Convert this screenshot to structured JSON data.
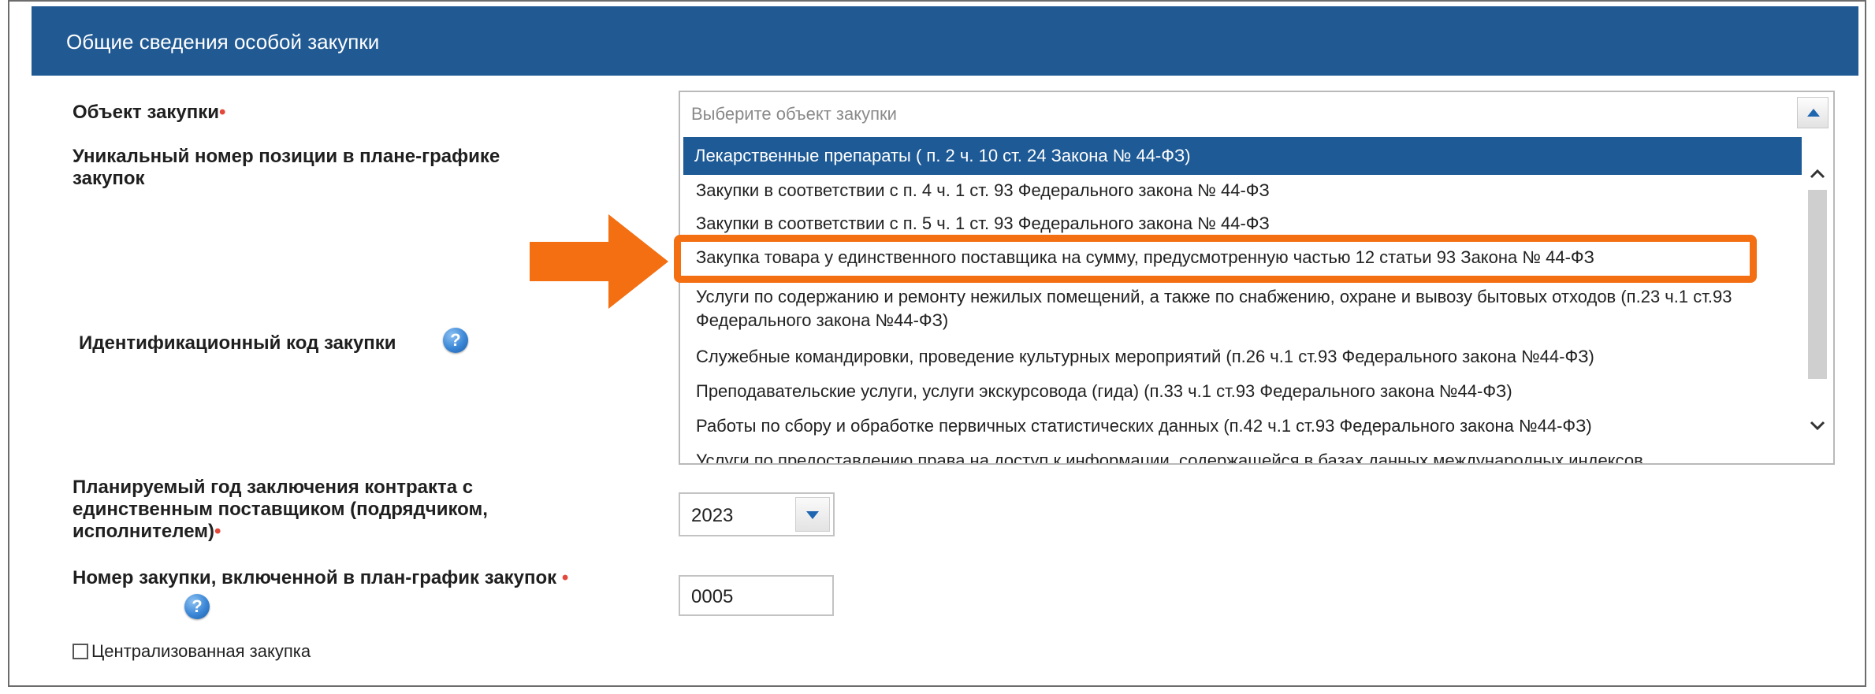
{
  "section": {
    "title": "Общие сведения особой закупки"
  },
  "fields": {
    "object_label": "Объект закупки",
    "required_mark": "•",
    "unique_position_label": "Уникальный номер позиции в плане-графике закупок",
    "identification_code_label": "Идентификационный код закупки",
    "planned_year_label": "Планируемый год заключения контракта с единственным поставщиком (подрядчиком, исполнителем)",
    "purchase_number_label": "Номер закупки, включенной в план-график закупок",
    "help_icon_glyph": "?"
  },
  "object_select": {
    "placeholder": "Выберите объект закупки",
    "options": [
      "Лекарственные препараты ( п. 2 ч. 10 ст. 24 Закона № 44-ФЗ)",
      "Закупки в соответствии с п. 4 ч. 1 ст. 93 Федерального закона № 44-ФЗ",
      "Закупки в соответствии с п. 5 ч. 1 ст. 93 Федерального закона № 44-ФЗ",
      "Закупка товара у единственного поставщика на сумму, предусмотренную частью 12 статьи 93 Закона № 44-ФЗ",
      "Услуги по содержанию и ремонту нежилых помещений, а также по снабжению, охране и вывозу бытовых отходов (п.23 ч.1 ст.93 Федерального закона №44-ФЗ)",
      "Служебные командировки, проведение культурных мероприятий (п.26 ч.1 ст.93 Федерального закона №44-ФЗ)",
      "Преподавательские услуги, услуги экскурсовода (гида) (п.33 ч.1 ст.93 Федерального закона №44-ФЗ)",
      "Работы по сбору и обработке первичных статистических данных (п.42 ч.1 ст.93 Федерального закона №44-ФЗ)",
      "Услуги по предоставлению права на доступ к информации, содержащейся в базах данных международных индексов"
    ],
    "selected_index": 0,
    "highlighted_index": 3
  },
  "year_select": {
    "value": "2023"
  },
  "purchase_number": {
    "value": "0005"
  },
  "centralized": {
    "label": "Централизованная закупка",
    "checked": false
  },
  "colors": {
    "header_bg": "#215a93",
    "selected_bg": "#1e5a96",
    "highlight": "#f36f12",
    "required": "#e2493b"
  }
}
